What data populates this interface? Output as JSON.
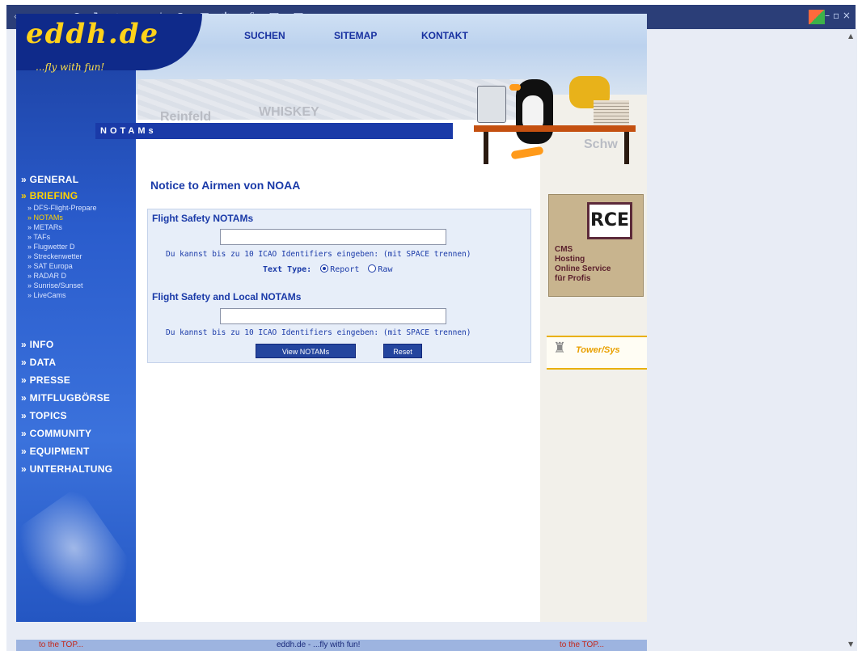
{
  "site": {
    "logo": "eddh.de",
    "tagline": "...fly with fun!"
  },
  "topnav": [
    "SUCHEN",
    "SITEMAP",
    "KONTAKT"
  ],
  "header": {
    "section_title": "NOTAMs",
    "map_words": [
      "Reinfeld",
      "WHISKEY",
      "Schw"
    ]
  },
  "sidebar": {
    "general": "» GENERAL",
    "briefing": "» BRIEFING",
    "briefing_items": [
      "» DFS-Flight-Prepare",
      "» NOTAMs",
      "» METARs",
      "» TAFs",
      "» Flugwetter D",
      "» Streckenwetter",
      "» SAT Europa",
      "» RADAR D",
      "» Sunrise/Sunset",
      "» LiveCams"
    ],
    "main_items": [
      "» INFO",
      "» DATA",
      "» PRESSE",
      "» MITFLUGBÖRSE",
      "» TOPICS",
      "» COMMUNITY",
      "» EQUIPMENT",
      "» UNTERHALTUNG"
    ]
  },
  "main": {
    "title": "Notice to Airmen von NOAA",
    "form1": {
      "heading": "Flight Safety NOTAMs",
      "value": "",
      "hint": "Du kannst bis zu 10 ICAO Identifiers eingeben: (mit SPACE trennen)",
      "text_type_label": "Text Type:",
      "option_report": "Report",
      "option_raw": "Raw",
      "selected": "Report"
    },
    "form2": {
      "heading": "Flight Safety and Local NOTAMs",
      "value": "",
      "hint": "Du kannst bis zu 10 ICAO Identifiers eingeben: (mit SPACE trennen)",
      "view_button": "View NOTAMs",
      "reset_button": "Reset"
    }
  },
  "ads": {
    "rce_logo": "RCE",
    "rce_lines": [
      "CMS",
      "Hosting",
      "Online Service",
      "für Profis"
    ],
    "tower_text": "Tower/Sys"
  },
  "footer": {
    "left": "to the TOP...",
    "center": "eddh.de - ...fly with fun!",
    "right": "to the TOP..."
  },
  "colors": {
    "nav_blue": "#1a3aa8",
    "active_yellow": "#ffd200",
    "footer_red": "#c4271a"
  }
}
